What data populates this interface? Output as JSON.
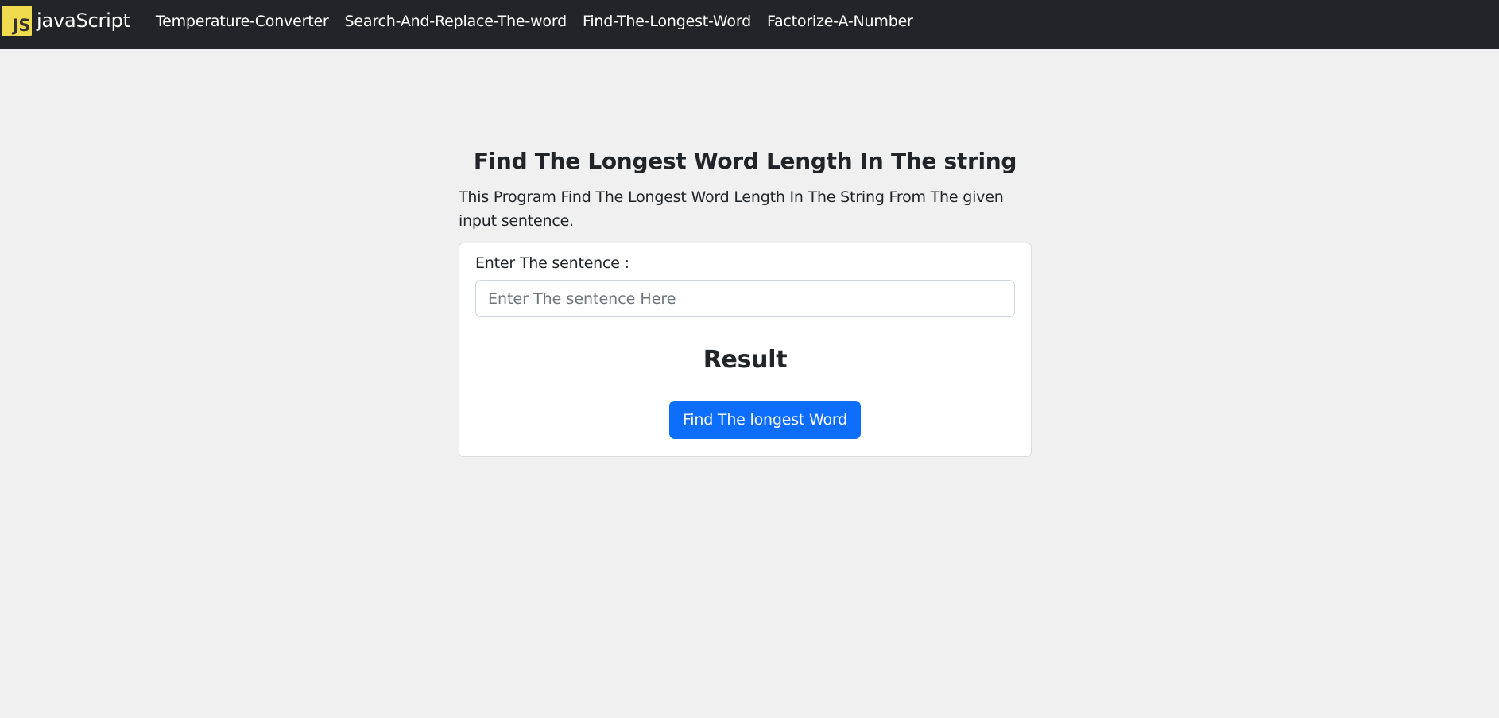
{
  "navbar": {
    "brand_logo_text": "JS",
    "brand_text": "javaScript",
    "links": [
      {
        "label": "Temperature-Converter"
      },
      {
        "label": "Search-And-Replace-The-word"
      },
      {
        "label": "Find-The-Longest-Word"
      },
      {
        "label": "Factorize-A-Number"
      }
    ]
  },
  "main": {
    "title": "Find The Longest Word Length In The string",
    "description": "This Program Find The Longest Word Length In The String From The given input sentence.",
    "card": {
      "input_label": "Enter The sentence :",
      "input_value": "",
      "input_placeholder": "Enter The sentence Here",
      "result_heading": "Result",
      "submit_label": "Find The longest Word"
    }
  },
  "colors": {
    "navbar_bg": "#212529",
    "page_bg": "#f0f0f0",
    "logo_bg": "#f0db4f",
    "primary": "#0d6efd"
  }
}
